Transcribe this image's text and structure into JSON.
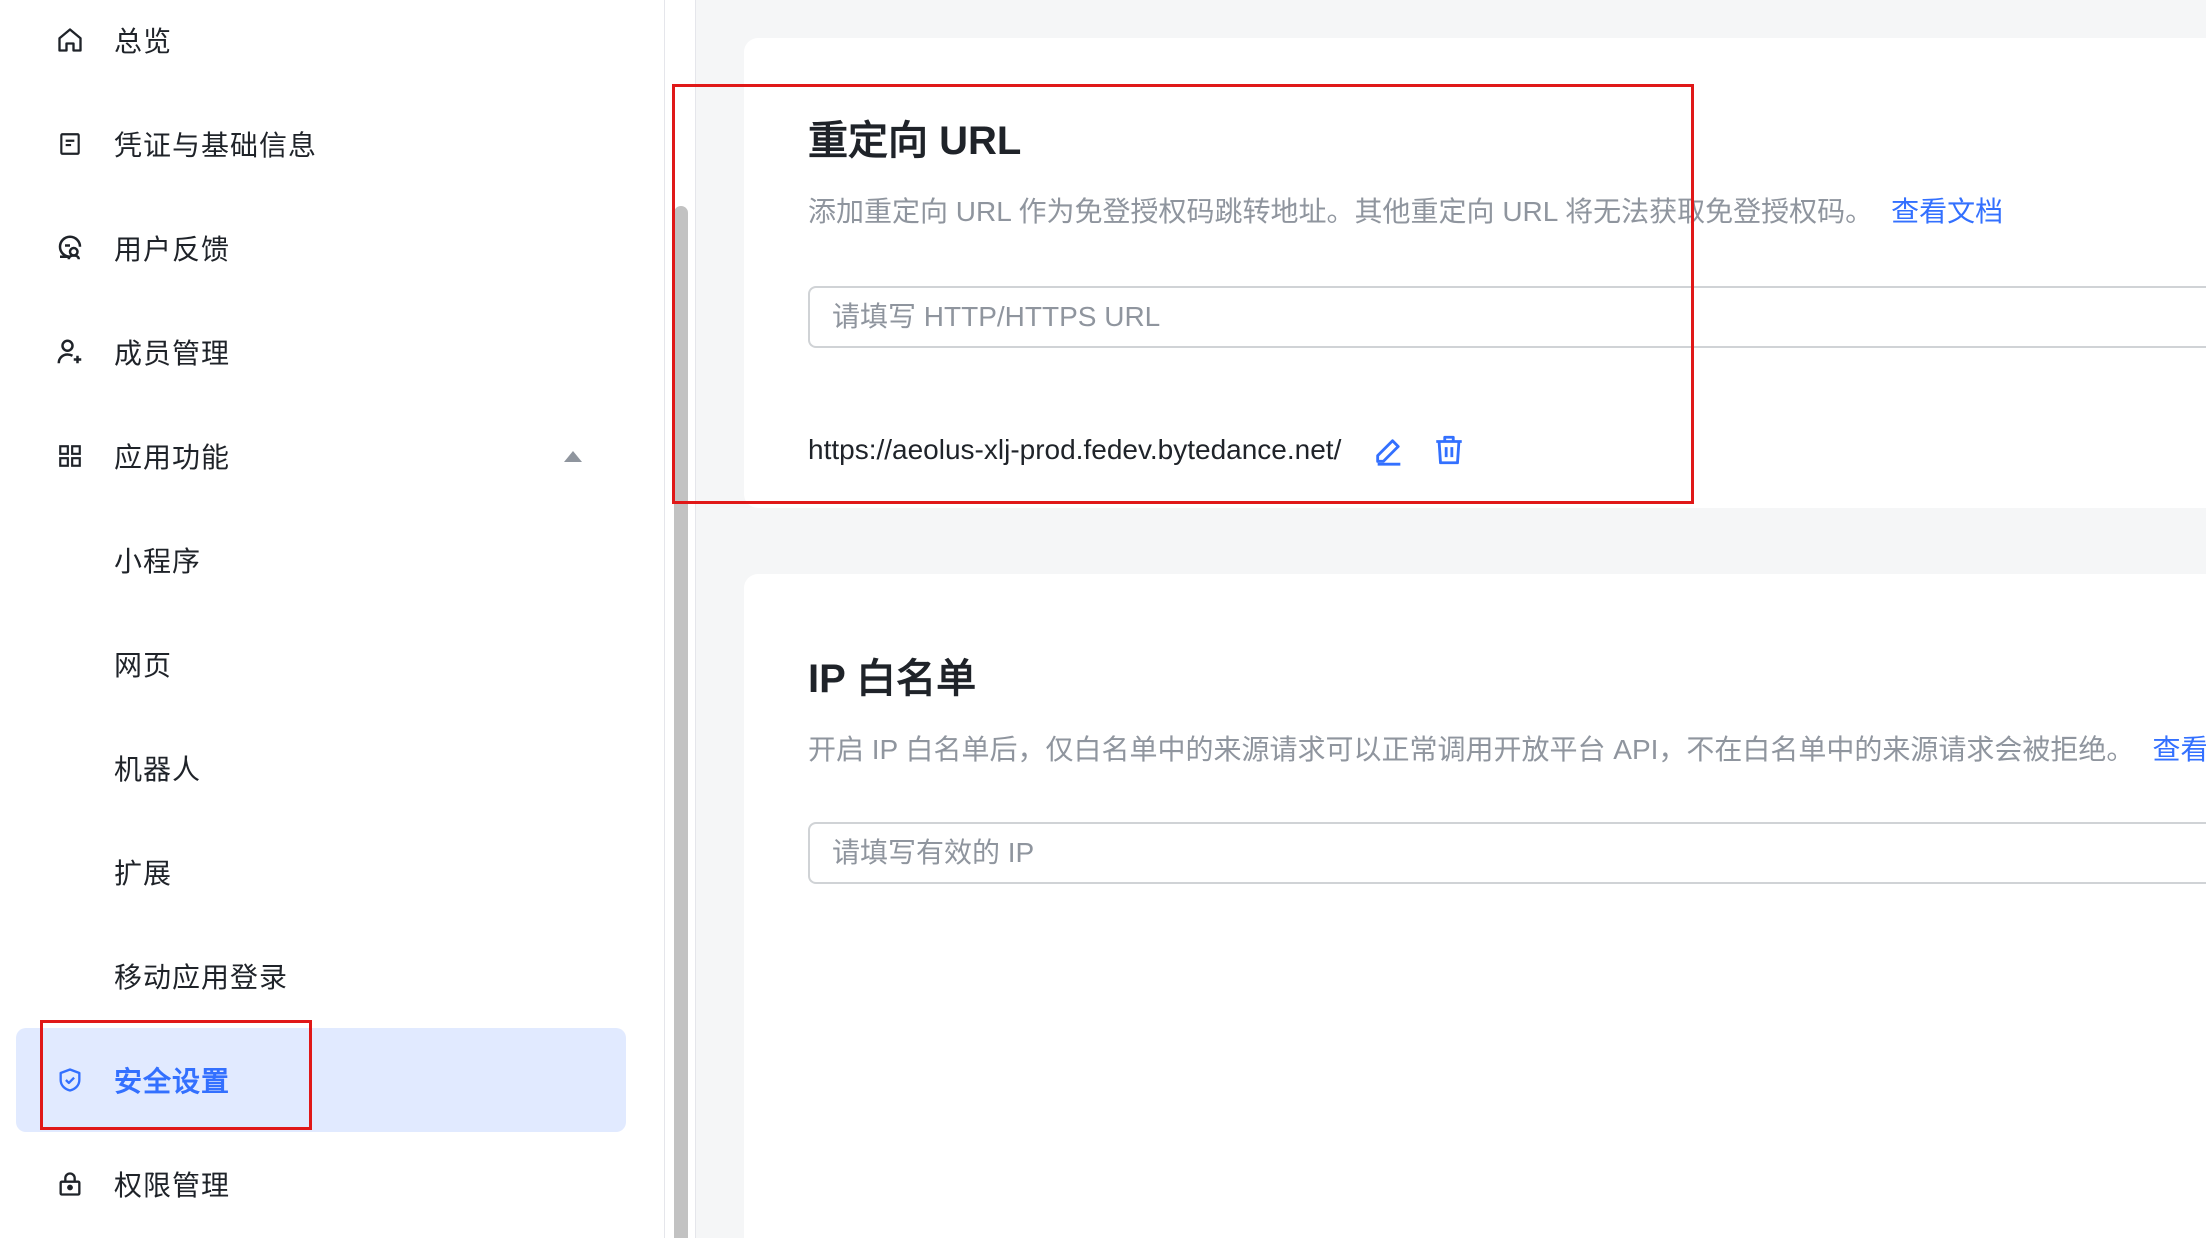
{
  "sidebar": {
    "items": [
      {
        "label": "总览",
        "icon": "home-icon"
      },
      {
        "label": "凭证与基础信息",
        "icon": "credential-icon"
      },
      {
        "label": "用户反馈",
        "icon": "feedback-icon"
      },
      {
        "label": "成员管理",
        "icon": "add-member-icon"
      },
      {
        "label": "应用功能",
        "icon": "grid-icon",
        "expanded": true
      },
      {
        "label": "小程序"
      },
      {
        "label": "网页"
      },
      {
        "label": "机器人"
      },
      {
        "label": "扩展"
      },
      {
        "label": "移动应用登录"
      },
      {
        "label": "安全设置",
        "icon": "shield-check-icon",
        "active": true
      },
      {
        "label": "权限管理",
        "icon": "lock-icon"
      }
    ]
  },
  "redirect": {
    "title": "重定向 URL",
    "desc": "添加重定向 URL 作为免登授权码跳转地址。其他重定向 URL 将无法获取免登授权码。",
    "doc_link": "查看文档",
    "placeholder": "请填写 HTTP/HTTPS URL",
    "url": "https://aeolus-xlj-prod.fedev.bytedance.net/"
  },
  "ip_whitelist": {
    "title": "IP 白名单",
    "desc": "开启 IP 白名单后，仅白名单中的来源请求可以正常调用开放平台 API，不在白名单中的来源请求会被拒绝。",
    "doc_link": "查看文",
    "placeholder": "请填写有效的 IP"
  },
  "colors": {
    "accent": "#3370ff",
    "active_bg": "#e1eaff",
    "annotation": "#e01818"
  }
}
